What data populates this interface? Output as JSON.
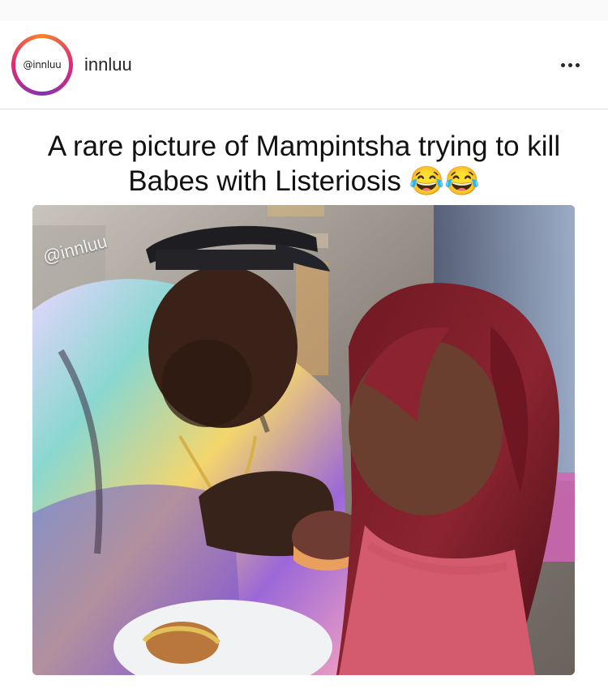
{
  "account": {
    "avatar_text": "@innluu",
    "username": "innluu"
  },
  "post": {
    "caption": "A rare picture of Mampintsha trying to kill Babes with Listeriosis 😂😂",
    "watermark": "@innluu"
  },
  "icons": {
    "more": "more-options-icon"
  }
}
